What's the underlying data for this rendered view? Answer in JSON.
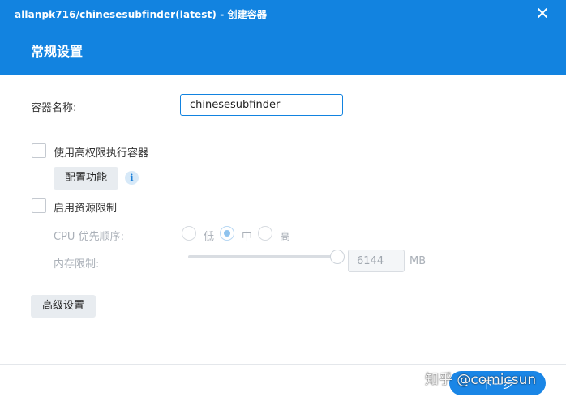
{
  "window": {
    "title": "allanpk716/chinesesubfinder(latest) - 创建容器",
    "section_title": "常规设置"
  },
  "form": {
    "container_name_label": "容器名称:",
    "container_name_value": "chinesesubfinder",
    "privileged_label": "使用高权限执行容器",
    "privileged_checked": false,
    "capabilities_button": "配置功能",
    "resource_limit_label": "启用资源限制",
    "resource_limit_checked": false,
    "cpu_priority_label": "CPU 优先顺序:",
    "cpu_options": [
      {
        "label": "低",
        "selected": false
      },
      {
        "label": "中",
        "selected": true
      },
      {
        "label": "高",
        "selected": false
      }
    ],
    "memory_label": "内存限制:",
    "memory_value": "6144",
    "memory_unit": "MB",
    "advanced_button": "高级设置"
  },
  "footer": {
    "next_button": "下一步",
    "watermark": "知乎 @comicsun"
  },
  "colors": {
    "header_bg": "#1283e0",
    "primary": "#1a86e6"
  },
  "icons": {
    "close": "close-icon",
    "info": "info-icon"
  }
}
